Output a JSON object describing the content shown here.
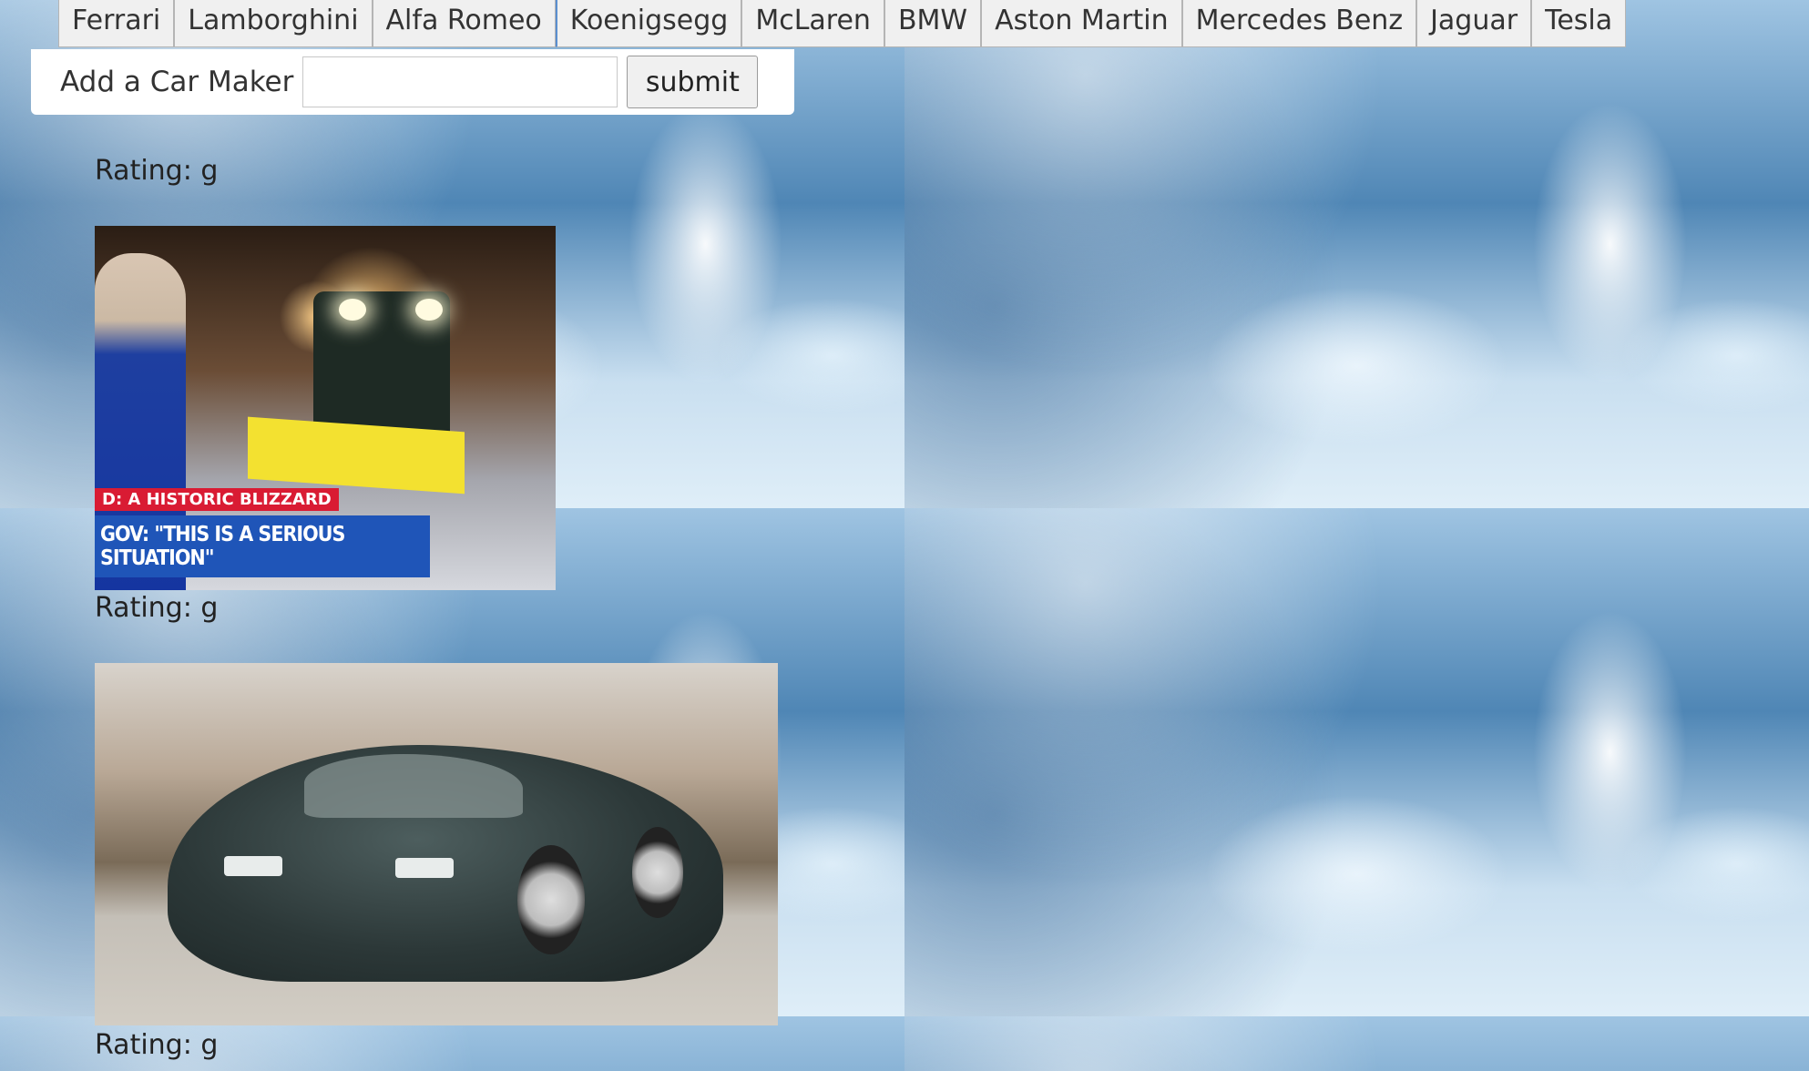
{
  "nav": {
    "tabs": [
      {
        "label": "Ferrari"
      },
      {
        "label": "Lamborghini"
      },
      {
        "label": "Alfa Romeo"
      },
      {
        "label": "Koenigsegg",
        "active": true
      },
      {
        "label": "McLaren"
      },
      {
        "label": "BMW"
      },
      {
        "label": "Aston Martin"
      },
      {
        "label": "Mercedes Benz"
      },
      {
        "label": "Jaguar"
      },
      {
        "label": "Tesla"
      }
    ]
  },
  "form": {
    "label": "Add a Car Maker",
    "input_value": "",
    "submit_label": "submit"
  },
  "results": [
    {
      "rating": "Rating: g",
      "image": "drake-snow-gif"
    },
    {
      "rating": "Rating: g",
      "image": "blizzard-news-gif",
      "ticker_red": "D: A HISTORIC BLIZZARD",
      "ticker_blue": "GOV: \"THIS IS A SERIOUS SITUATION\""
    },
    {
      "rating": "Rating: g",
      "image": "bugatti-car-gif"
    }
  ]
}
